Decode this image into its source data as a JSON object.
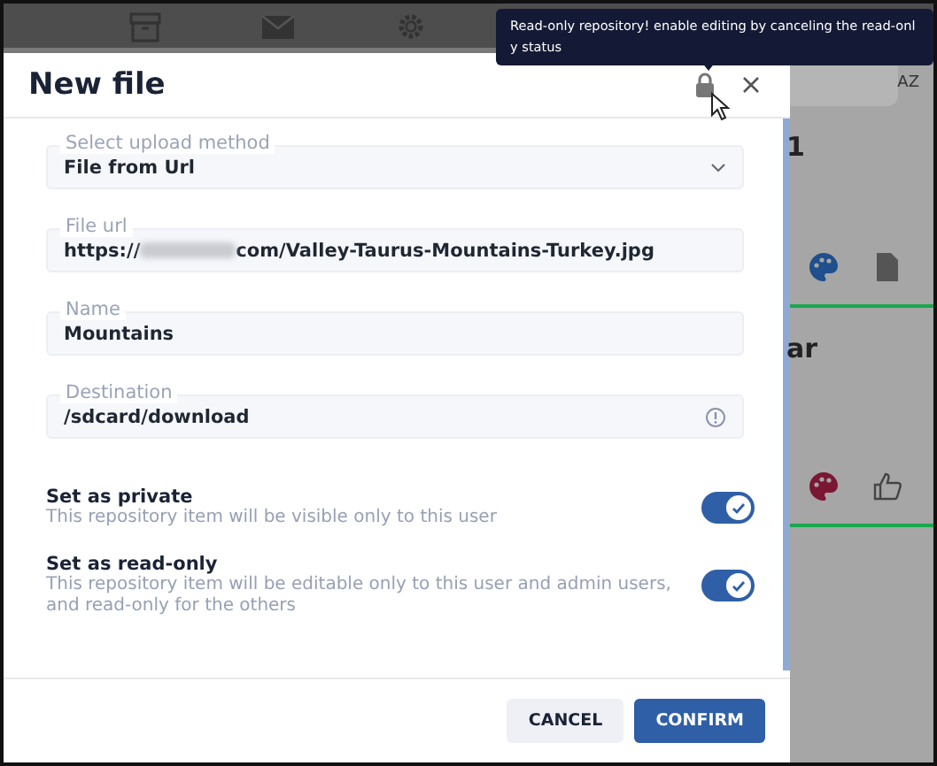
{
  "backdrop": {
    "sort_label": "AZ",
    "card_1_title": "1",
    "card_2_title": "ar"
  },
  "tooltip": {
    "text": "Read-only repository! enable editing by canceling the read-onl y status"
  },
  "dialog": {
    "title": "New file",
    "locked": true,
    "fields": [
      {
        "kind": "select",
        "label": "Select upload method",
        "value": "File from Url"
      },
      {
        "kind": "url",
        "label": "File url",
        "url_prefix": "https://",
        "url_suffix": "com/Valley-Taurus-Mountains-Turkey.jpg"
      },
      {
        "kind": "text",
        "label": "Name",
        "value": "Mountains"
      },
      {
        "kind": "info",
        "label": "Destination",
        "value": "/sdcard/download"
      }
    ],
    "toggles": [
      {
        "title": "Set as private",
        "description": "This repository item will be visible only to this user",
        "on": true
      },
      {
        "title": "Set as read-only",
        "description": "This repository item will be editable only to this user and admin users, and read-only for the others",
        "on": true
      }
    ],
    "buttons": [
      {
        "kind": "secondary",
        "label": "CANCEL"
      },
      {
        "kind": "primary",
        "label": "CONFIRM"
      }
    ]
  }
}
